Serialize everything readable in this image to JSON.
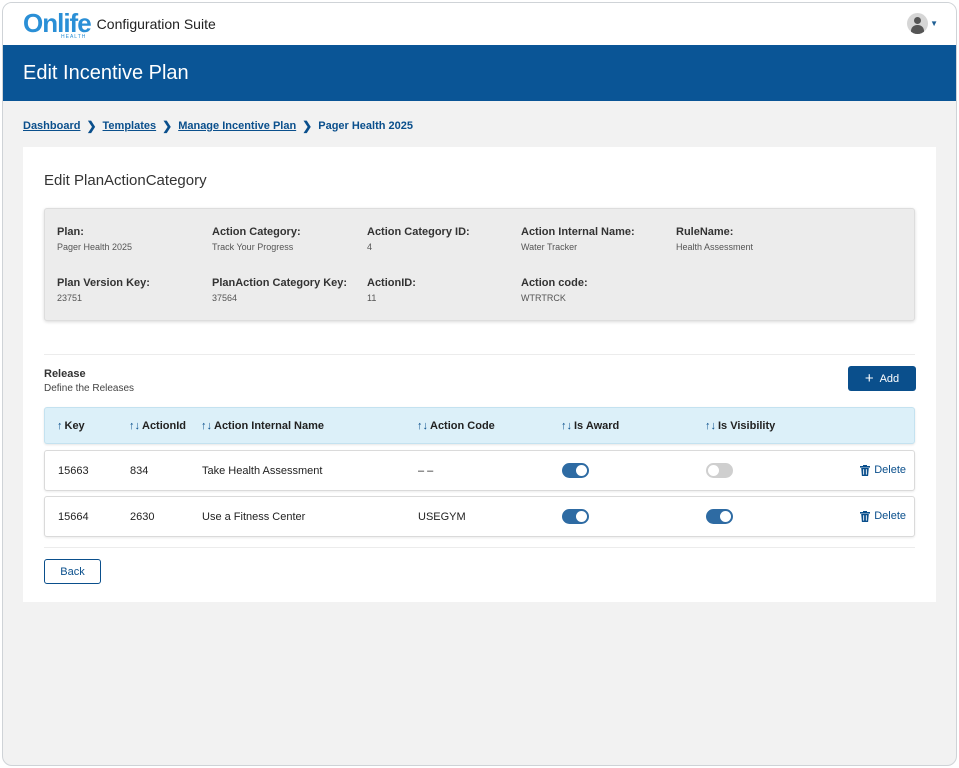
{
  "app": {
    "logo_text": "Onlife",
    "logo_subtext": "HEALTH",
    "title": "Configuration Suite"
  },
  "page": {
    "heading": "Edit Incentive Plan"
  },
  "breadcrumb": {
    "items": [
      "Dashboard",
      "Templates",
      "Manage Incentive Plan"
    ],
    "current": "Pager Health 2025",
    "separator": "❯"
  },
  "card": {
    "title": "Edit PlanActionCategory"
  },
  "info": {
    "plan_label": "Plan:",
    "plan_value": "Pager Health 2025",
    "action_category_label": "Action Category:",
    "action_category_value": "Track Your Progress",
    "action_category_id_label": "Action Category ID:",
    "action_category_id_value": "4",
    "action_internal_name_label": "Action Internal Name:",
    "action_internal_name_value": "Water Tracker",
    "rule_name_label": "RuleName:",
    "rule_name_value": "Health Assessment",
    "plan_version_key_label": "Plan Version Key:",
    "plan_version_key_value": "23751",
    "planaction_category_key_label": "PlanAction Category Key:",
    "planaction_category_key_value": "37564",
    "action_id_label": "ActionID:",
    "action_id_value": "11",
    "action_code_label": "Action code:",
    "action_code_value": "WTRTRCK"
  },
  "release": {
    "title": "Release",
    "subtitle": "Define the Releases",
    "add_label": "Add"
  },
  "table": {
    "columns": [
      {
        "sort": "↑",
        "label": "Key"
      },
      {
        "sort": "↑↓",
        "label": "ActionId"
      },
      {
        "sort": "↑↓",
        "label": "Action Internal Name"
      },
      {
        "sort": "↑↓",
        "label": "Action Code"
      },
      {
        "sort": "↑↓",
        "label": "Is Award"
      },
      {
        "sort": "↑↓",
        "label": "Is Visibility"
      }
    ],
    "rows": [
      {
        "key": "15663",
        "action_id": "834",
        "name": "Take Health Assessment",
        "code": "– –",
        "is_award": true,
        "is_visibility": false,
        "delete_label": "Delete"
      },
      {
        "key": "15664",
        "action_id": "2630",
        "name": "Use a Fitness Center",
        "code": "USEGYM",
        "is_award": true,
        "is_visibility": true,
        "delete_label": "Delete"
      }
    ]
  },
  "back_label": "Back",
  "colors": {
    "brand": "#2a8fd6",
    "banner": "#0a5596",
    "accent": "#0a4f8c",
    "table_header": "#dcf0f9",
    "toggle_on": "#2e6ba3",
    "toggle_off": "#cfcfcf"
  },
  "icons": {
    "breadcrumb_separator": "chevron-right-icon",
    "user_menu": "user-avatar-icon",
    "user_menu_caret": "caret-down-icon",
    "add": "plus-icon",
    "delete": "trash-icon",
    "sort": "sort-icon"
  }
}
